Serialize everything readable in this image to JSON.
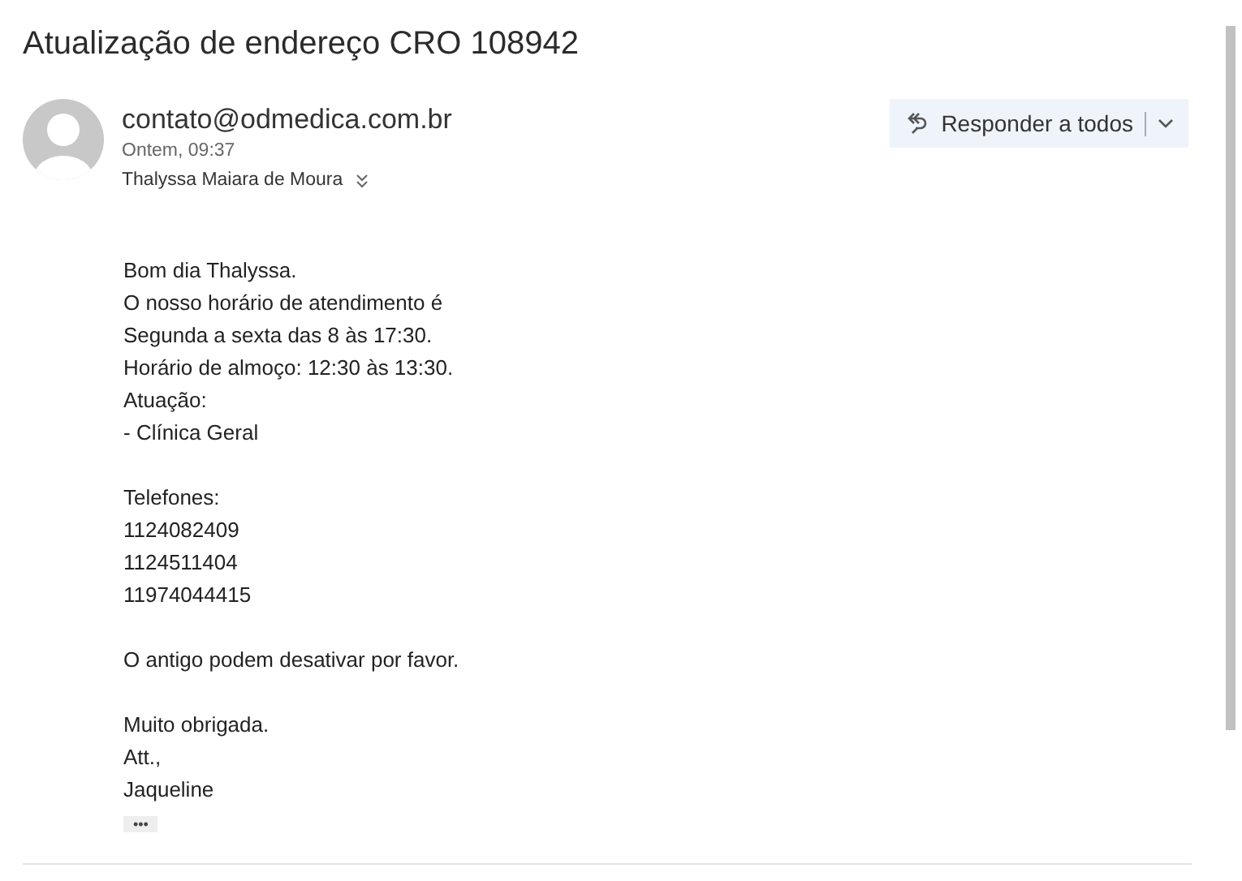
{
  "subject": "Atualização de endereço CRO 108942",
  "sender": {
    "email": "contato@odmedica.com.br",
    "time": "Ontem, 09:37",
    "recipient": "Thalyssa Maiara de Moura"
  },
  "reply_button": {
    "label": "Responder a todos"
  },
  "body": [
    [
      "Bom dia Thalyssa.",
      "O nosso horário de atendimento é",
      "Segunda a sexta das 8 às 17:30.",
      "Horário de almoço: 12:30 às 13:30.",
      "Atuação:",
      "- Clínica Geral"
    ],
    [
      "Telefones:",
      "1124082409",
      "1124511404",
      "11974044415"
    ],
    [
      "O antigo podem desativar por favor."
    ],
    [
      "Muito obrigada.",
      "Att.,",
      "Jaqueline"
    ]
  ],
  "more_button": {
    "label": "•••"
  }
}
